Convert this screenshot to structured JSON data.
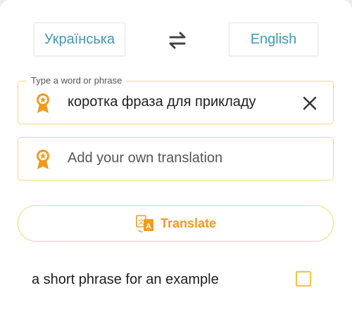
{
  "languages": {
    "source": "Українська",
    "target": "English"
  },
  "word_field": {
    "legend": "Type a word or phrase",
    "value": "коротка фраза для прикладу"
  },
  "own_translation": {
    "placeholder": "Add your own translation"
  },
  "translate_button": {
    "label": "Translate"
  },
  "results": [
    {
      "text": "a short phrase for an example",
      "checked": false
    }
  ],
  "colors": {
    "accent": "#f39a1e",
    "field_border": "#f5d777",
    "language_text": "#3e9ab6",
    "checkbox_border": "#f5c43c"
  },
  "icons": {
    "swap": "swap-arrows-icon",
    "field_badge": "award-badge-icon",
    "clear": "close-icon",
    "translate": "translate-icon"
  }
}
